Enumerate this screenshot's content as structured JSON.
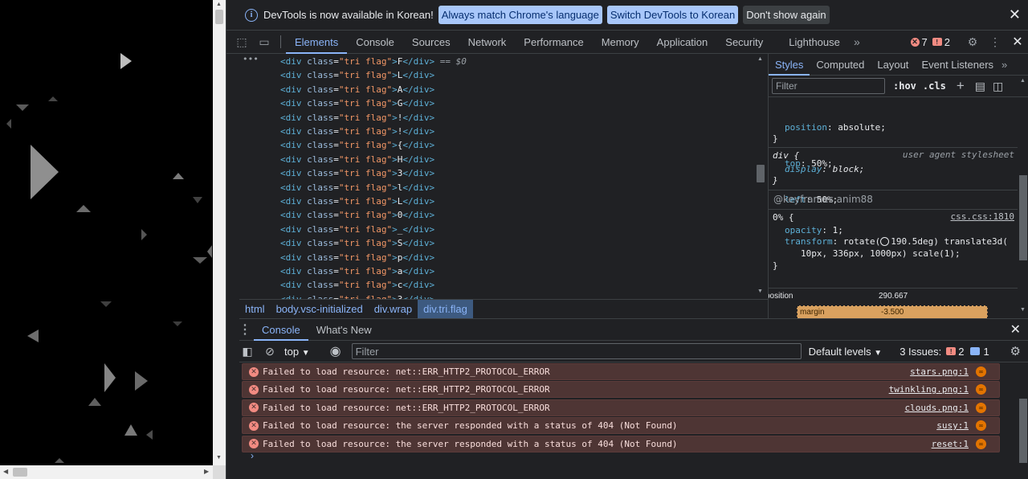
{
  "infobar": {
    "message": "DevTools is now available in Korean!",
    "btn_match": "Always match Chrome's language",
    "btn_switch": "Switch DevTools to Korean",
    "btn_dismiss": "Don't show again"
  },
  "toolbar": {
    "tabs": [
      "Elements",
      "Console",
      "Sources",
      "Network",
      "Performance",
      "Memory",
      "Application",
      "Security",
      "Lighthouse"
    ],
    "active_tab": "Elements",
    "error_count": "7",
    "warning_count": "2"
  },
  "elements": {
    "rows": [
      {
        "text": "F",
        "selected_suffix": "== $0"
      },
      {
        "text": "L"
      },
      {
        "text": "A"
      },
      {
        "text": "G"
      },
      {
        "text": "!"
      },
      {
        "text": "!"
      },
      {
        "text": "{"
      },
      {
        "text": "H"
      },
      {
        "text": "3"
      },
      {
        "text": "l"
      },
      {
        "text": "L"
      },
      {
        "text": "0"
      },
      {
        "text": "_"
      },
      {
        "text": "S"
      },
      {
        "text": "p"
      },
      {
        "text": "a"
      },
      {
        "text": "c"
      },
      {
        "text": "3"
      }
    ],
    "tag_open": "<div",
    "attr_name": "class",
    "attr_value": "\"tri flag\"",
    "tag_close": "</div>"
  },
  "breadcrumbs": [
    "html",
    "body.vsc-initialized",
    "div.wrap",
    "div.tri.flag"
  ],
  "styles": {
    "tabs": [
      "Styles",
      "Computed",
      "Layout",
      "Event Listeners"
    ],
    "filter_placeholder": "Filter",
    "hov": ":hov",
    "cls": ".cls",
    "rule1": [
      {
        "prop": "position",
        "val": "absolute;"
      },
      {
        "prop": "top",
        "val": "50%;"
      },
      {
        "prop": "left",
        "val": "50%;"
      }
    ],
    "rule2_selector": "div {",
    "rule2_source": "user agent stylesheet",
    "rule2_prop": "display",
    "rule2_val": "block;",
    "keyframes_label": "@keyframes anim88",
    "kf_selector": "0% {",
    "kf_source": "css.css:1810",
    "kf_opacity_prop": "opacity",
    "kf_opacity_val": "1;",
    "kf_transform_prop": "transform",
    "kf_transform_val1": "rotate(",
    "kf_transform_val2": "190.5deg) translate3d(",
    "kf_transform_val3": "10px, 336px, 1000px) scale(1);",
    "close_brace": "}",
    "box_position_label": "position",
    "box_position_value": "290.667",
    "box_margin_label": "margin",
    "box_margin_value": "-3.500"
  },
  "drawer": {
    "tabs": [
      "Console",
      "What's New"
    ],
    "context": "top",
    "filter_placeholder": "Filter",
    "levels": "Default levels",
    "issues_label": "3 Issues:",
    "issues_errors": "2",
    "issues_info": "1",
    "messages": [
      {
        "text": "Failed to load resource: net::ERR_HTTP2_PROTOCOL_ERROR",
        "source": "stars.png:1"
      },
      {
        "text": "Failed to load resource: net::ERR_HTTP2_PROTOCOL_ERROR",
        "source": "twinkling.png:1"
      },
      {
        "text": "Failed to load resource: net::ERR_HTTP2_PROTOCOL_ERROR",
        "source": "clouds.png:1"
      },
      {
        "text": "Failed to load resource: the server responded with a status of 404 (Not Found)",
        "source": "susy:1"
      },
      {
        "text": "Failed to load resource: the server responded with a status of 404 (Not Found)",
        "source": "reset:1"
      }
    ]
  },
  "icons": {
    "info": "info-icon",
    "inspect": "inspect-element-icon",
    "device": "device-toolbar-icon",
    "more_tabs": "chevron-double-right-icon",
    "settings": "gear-icon",
    "kebab": "more-vert-icon",
    "close": "close-icon"
  },
  "colors": {
    "accent": "#8ab4f8",
    "error_bg": "#4e3534",
    "error": "#f28b82",
    "background": "#202124"
  }
}
